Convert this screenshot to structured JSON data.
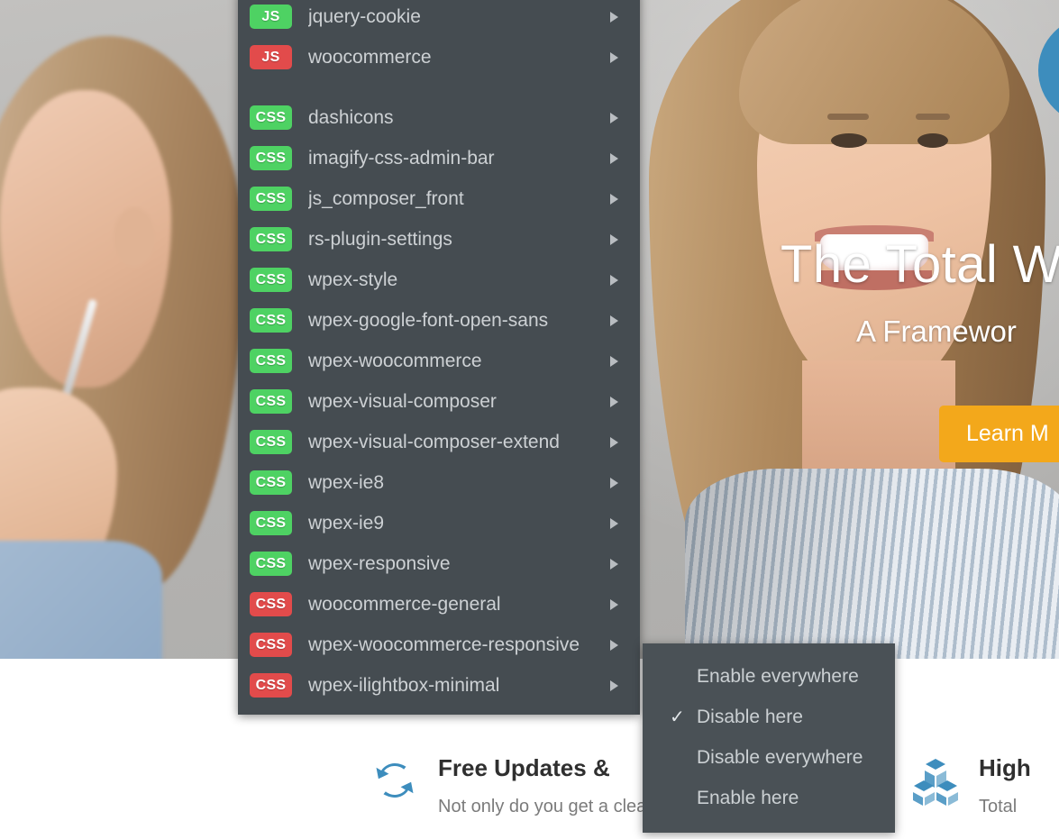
{
  "page": {
    "hero": {
      "title": "The Total W",
      "subtitle": "A Framewor",
      "cta_label": "Learn M",
      "cta_color": "#f3a81b"
    },
    "features": [
      {
        "icon": "refresh-sync-icon",
        "title": "Free Updates &",
        "desc": "Not only do you get a clean and well"
      },
      {
        "icon": "blocks-cubes-icon",
        "title": "High",
        "desc": "Total"
      }
    ],
    "accent_color": "#3d8dbd"
  },
  "asset_menu": {
    "background_color": "#454c51",
    "badge_enabled_color": "#4ed263",
    "badge_disabled_color": "#e24b4b",
    "groups": [
      {
        "type": "JS",
        "items": [
          {
            "badge": "JS",
            "label": "jquery-cookie",
            "state": "green"
          },
          {
            "badge": "JS",
            "label": "woocommerce",
            "state": "red"
          }
        ]
      },
      {
        "type": "CSS",
        "items": [
          {
            "badge": "CSS",
            "label": "dashicons",
            "state": "green"
          },
          {
            "badge": "CSS",
            "label": "imagify-css-admin-bar",
            "state": "green"
          },
          {
            "badge": "CSS",
            "label": "js_composer_front",
            "state": "green"
          },
          {
            "badge": "CSS",
            "label": "rs-plugin-settings",
            "state": "green"
          },
          {
            "badge": "CSS",
            "label": "wpex-style",
            "state": "green"
          },
          {
            "badge": "CSS",
            "label": "wpex-google-font-open-sans",
            "state": "green"
          },
          {
            "badge": "CSS",
            "label": "wpex-woocommerce",
            "state": "green"
          },
          {
            "badge": "CSS",
            "label": "wpex-visual-composer",
            "state": "green"
          },
          {
            "badge": "CSS",
            "label": "wpex-visual-composer-extend",
            "state": "green"
          },
          {
            "badge": "CSS",
            "label": "wpex-ie8",
            "state": "green"
          },
          {
            "badge": "CSS",
            "label": "wpex-ie9",
            "state": "green"
          },
          {
            "badge": "CSS",
            "label": "wpex-responsive",
            "state": "green"
          },
          {
            "badge": "CSS",
            "label": "woocommerce-general",
            "state": "red"
          },
          {
            "badge": "CSS",
            "label": "wpex-woocommerce-responsive",
            "state": "red"
          },
          {
            "badge": "CSS",
            "label": "wpex-ilightbox-minimal",
            "state": "red"
          }
        ]
      }
    ]
  },
  "asset_submenu": {
    "background_color": "#4a5156",
    "items": [
      {
        "label": "Enable everywhere",
        "checked": false
      },
      {
        "label": "Disable here",
        "checked": true
      },
      {
        "label": "Disable everywhere",
        "checked": false
      },
      {
        "label": "Enable here",
        "checked": false
      }
    ],
    "check_glyph": "✓"
  }
}
